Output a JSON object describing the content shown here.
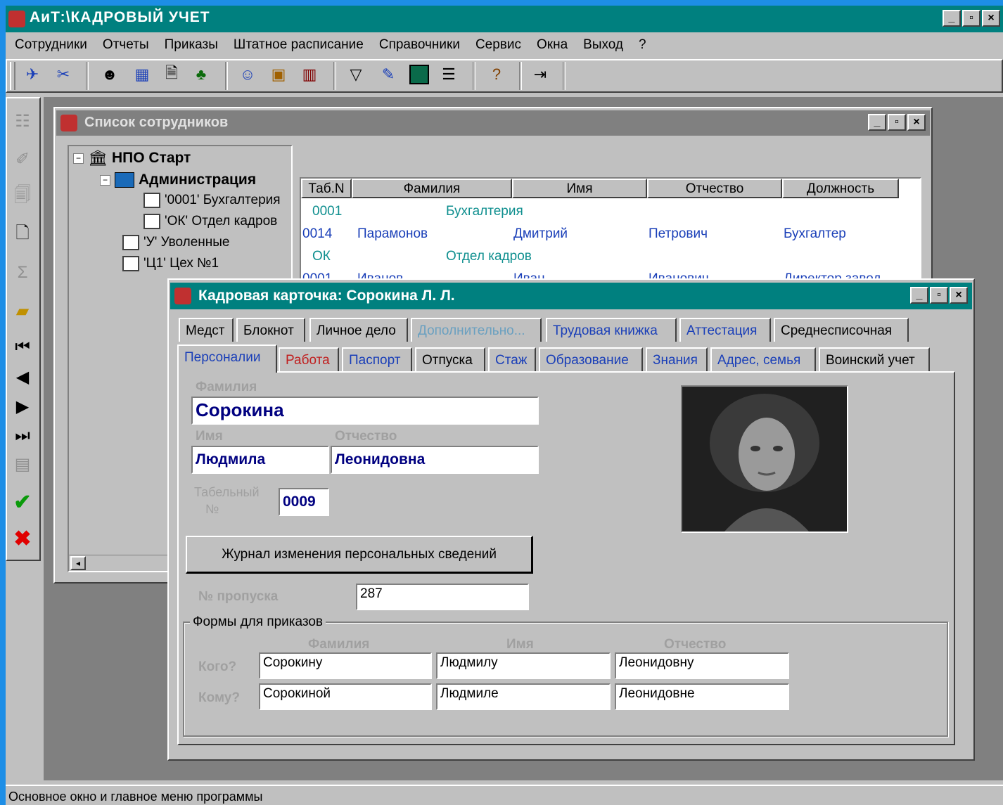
{
  "app": {
    "title": "АиТ:\\КАДРОВЫЙ УЧЕТ",
    "win_min": "_",
    "win_max": "▫",
    "win_close": "×"
  },
  "menu": [
    "Сотрудники",
    "Отчеты",
    "Приказы",
    "Штатное расписание",
    "Справочники",
    "Сервис",
    "Окна",
    "Выход",
    "?"
  ],
  "colors": {
    "title_bg": "#00807f",
    "face": "#c0c0c0",
    "desktop": "#808080",
    "link_blue": "#1a3fb8",
    "dept_teal": "#0f8f8f",
    "field_blue": "#000080"
  },
  "toolbar_icons": [
    "connect-icon",
    "disconnect-icon",
    "person-search-icon",
    "table-icon",
    "document-icon",
    "tree-icon",
    "people-icon",
    "card-icon",
    "grid-icon",
    "filter-icon",
    "edit-icon",
    "green-box-icon",
    "list-icon",
    "help-icon",
    "exit-icon"
  ],
  "list_window": {
    "title": "Список сотрудников",
    "tree": [
      {
        "label": "НПО Старт",
        "level": 0,
        "bold": true
      },
      {
        "label": "Администрация",
        "level": 1,
        "bold": true
      },
      {
        "label": "'0001' Бухгалтерия",
        "level": 2,
        "bold": false
      },
      {
        "label": "'ОК' Отдел кадров",
        "level": 2,
        "bold": false
      },
      {
        "label": "'У' Уволенные",
        "level": 1,
        "bold": false
      },
      {
        "label": "'Ц1' Цех №1",
        "level": 1,
        "bold": false
      }
    ],
    "columns": [
      "Таб.N",
      "Фамилия",
      "Имя",
      "Отчество",
      "Должность"
    ],
    "rows": [
      {
        "tab": "0001",
        "dept": "Бухгалтерия",
        "type": "dept"
      },
      {
        "tab": "0014",
        "last": "Парамонов",
        "first": "Дмитрий",
        "middle": "Петрович",
        "position": "Бухгалтер",
        "type": "person"
      },
      {
        "tab": "ОК",
        "dept": "Отдел кадров",
        "type": "dept"
      },
      {
        "tab": "0001",
        "last": "Иванов",
        "first": "Иван",
        "middle": "Иванович",
        "position": "Директор завод",
        "type": "person"
      }
    ]
  },
  "card": {
    "title": "Кадровая карточка: Сорокина Л. Л.",
    "tabs_row1": [
      "Медст",
      "Блокнот",
      "Личное дело",
      "Дополнительно...",
      "Трудовая книжка",
      "Аттестация",
      "Среднесписочная"
    ],
    "tabs_row2": [
      "Персоналии",
      "Работа",
      "Паспорт",
      "Отпуска",
      "Стаж",
      "Образование",
      "Знания",
      "Адрес, семья",
      "Воинский учет"
    ],
    "labels": {
      "last": "Фамилия",
      "first": "Имя",
      "middle": "Отчество",
      "tab_num_1": "Табельный",
      "tab_num_2": "№",
      "pass": "№ пропуска",
      "forms_group": "Формы для приказов",
      "whom": "Кого?",
      "to_whom": "Кому?"
    },
    "values": {
      "last": "Сорокина",
      "first": "Людмила",
      "middle": "Леонидовна",
      "tab_num": "0009",
      "pass": "287"
    },
    "journal_button": "Журнал изменения персональных сведений",
    "forms": {
      "headers": [
        "Фамилия",
        "Имя",
        "Отчество"
      ],
      "whom": [
        "Сорокину",
        "Людмилу",
        "Леонидовну"
      ],
      "to_whom": [
        "Сорокиной",
        "Людмиле",
        "Леонидовне"
      ]
    }
  },
  "status": "Основное окно и главное меню программы"
}
